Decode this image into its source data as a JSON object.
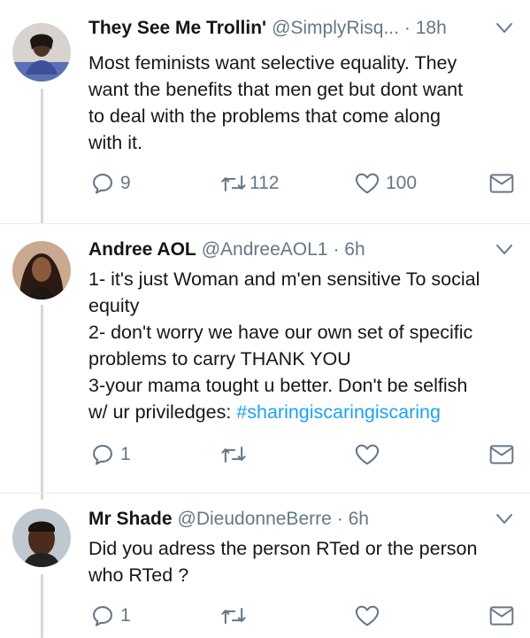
{
  "colors": {
    "text": "#14171a",
    "secondary": "#657786",
    "link": "#1da1f2",
    "thread_line": "#cfd9de",
    "divider": "#e6ecf0"
  },
  "tweets": [
    {
      "name": "They See Me Trollin'",
      "handle": "@SimplyRisq...",
      "time": "· 18h",
      "lines": [
        "Most feminists want selective equality. They",
        "want the benefits that men get but dont want",
        "to deal with the problems that come along",
        "with it."
      ],
      "replies": "9",
      "retweets": "112",
      "likes": "100",
      "icons": [
        "reply-icon",
        "retweet-icon",
        "like-icon",
        "dm-icon",
        "chevron-down-icon"
      ]
    },
    {
      "name": "Andree AOL",
      "handle": "@AndreeAOL1",
      "time": "· 6h",
      "lines": [
        "1- it's just Woman and m'en sensitive To social",
        "equity",
        "2- don't worry we have our own set of specific",
        "problems to carry THANK YOU",
        "3-your mama tought u better. Don't be selfish"
      ],
      "last_line_prefix": "w/ ur priviledges: ",
      "hashtag": "#sharingiscaringiscaring",
      "replies": "1",
      "retweets": "",
      "likes": "",
      "icons": [
        "reply-icon",
        "retweet-icon",
        "like-icon",
        "dm-icon",
        "chevron-down-icon"
      ]
    },
    {
      "name": "Mr Shade",
      "handle": "@DieudonneBerre",
      "time": "· 6h",
      "lines": [
        "Did you adress the person RTed or the person",
        "who RTed ?"
      ],
      "replies": "1",
      "retweets": "",
      "likes": "",
      "icons": [
        "reply-icon",
        "retweet-icon",
        "like-icon",
        "dm-icon",
        "chevron-down-icon"
      ]
    }
  ]
}
